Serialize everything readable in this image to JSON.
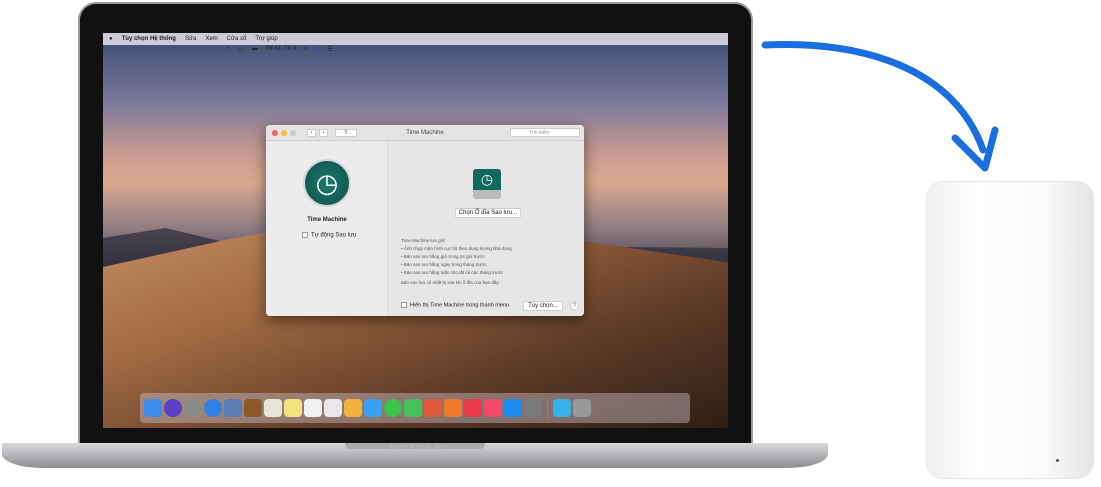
{
  "menubar": {
    "app": "Tùy chọn Hệ thống",
    "items": [
      "Sửa",
      "Xem",
      "Cửa sổ",
      "Trợ giúp"
    ],
    "clock": "09:41, Th 4"
  },
  "window": {
    "title": "Time Machine",
    "search_placeholder": "Tìm kiếm",
    "pane_name": "Time Machine",
    "auto_backup": "Tự động Sao lưu",
    "select_disk": "Chọn Ổ đĩa Sao lưu...",
    "info_title": "Time Machine lưu giữ:",
    "info_items": [
      "• Ảnh chụp màn hình cục bộ theo dung lượng khả dụng",
      "• Bản sao lưu hằng giờ trong 24 giờ trước",
      "• Bản sao lưu hằng ngày trong tháng trước",
      "• Bản sao lưu hằng tuần cho tất cả các tháng trước"
    ],
    "info_note": "Bản sao lưu cũ nhất bị xóa khi ổ đĩa của bạn đầy.",
    "show_menu": "Hiển thị Time Machine trong thanh menu",
    "options": "Tùy chọn...",
    "help": "?"
  },
  "laptop_label": "MacBook Air",
  "colors": {
    "arrow": "#1a6fe0",
    "tm": "#0c5e54"
  },
  "dock_apps": [
    "#3a8ee6",
    "#5b3fc8",
    "#8a8a8a",
    "#2f7fe6",
    "#5a7ab8",
    "#8b5a2b",
    "#e9e4d8",
    "#f4e27c",
    "#f0f0f0",
    "#e8e8e8",
    "#f2b13b",
    "#3aa0f0",
    "#3fc24a",
    "#43c45a",
    "#e05a3a",
    "#f27a2a",
    "#e83a4a",
    "#f04a6a",
    "#1e8cf0",
    "#7a7a7a",
    "#3ab0e8",
    "#9a9a9a"
  ]
}
